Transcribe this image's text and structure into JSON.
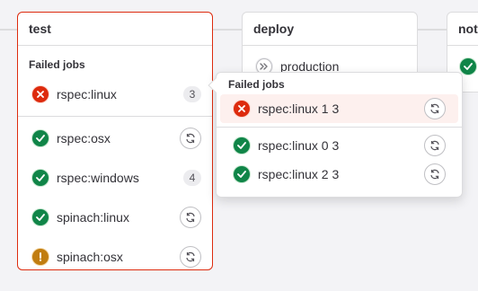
{
  "stages": {
    "test": {
      "title": "test",
      "group_label": "Failed jobs",
      "jobs": [
        {
          "name": "rspec:linux",
          "status": "failed",
          "count": "3"
        },
        {
          "name": "rspec:osx",
          "status": "success"
        },
        {
          "name": "rspec:windows",
          "status": "success",
          "count": "4"
        },
        {
          "name": "spinach:linux",
          "status": "success"
        },
        {
          "name": "spinach:osx",
          "status": "warning"
        }
      ]
    },
    "deploy": {
      "title": "deploy",
      "jobs": [
        {
          "name": "production",
          "status": "manual"
        }
      ]
    },
    "notify": {
      "title": "notify",
      "jobs": [
        {
          "status": "success"
        }
      ]
    }
  },
  "dropdown": {
    "group_label": "Failed jobs",
    "jobs": [
      {
        "name": "rspec:linux 1 3",
        "status": "failed"
      },
      {
        "name": "rspec:linux 0 3",
        "status": "success"
      },
      {
        "name": "rspec:linux 2 3",
        "status": "success"
      }
    ]
  },
  "colors": {
    "failed": "#dd2b0e",
    "success": "#108548",
    "warning": "#c17d10",
    "border": "#dcdcde"
  },
  "icons": [
    "failed-status-icon",
    "success-status-icon",
    "warning-status-icon",
    "manual-status-icon",
    "retry-icon"
  ]
}
